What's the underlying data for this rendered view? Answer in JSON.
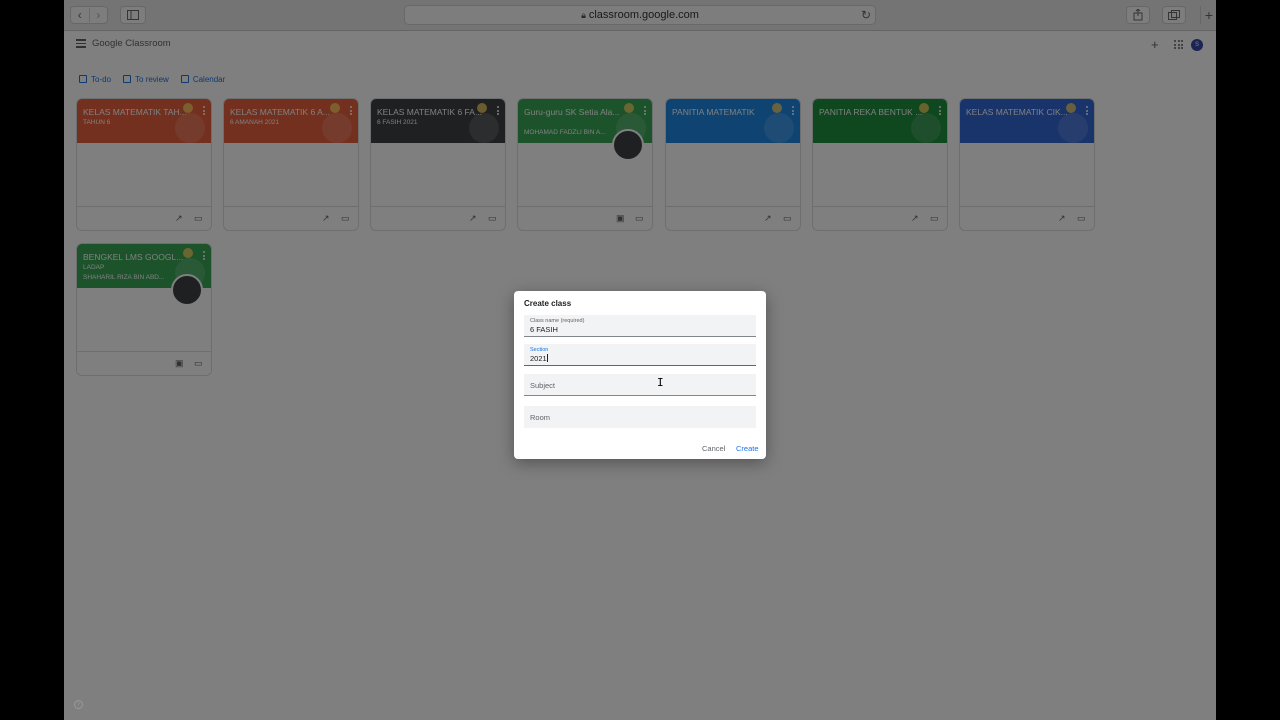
{
  "browser": {
    "url": "classroom.google.com",
    "back_icon": "chevron-left-icon",
    "forward_icon": "chevron-right-icon"
  },
  "appbar": {
    "brand_google": "Google",
    "brand_product": "Classroom",
    "avatar_initial": "S"
  },
  "subnav": [
    {
      "label": "To-do",
      "icon": "todo-icon"
    },
    {
      "label": "To review",
      "icon": "folder-icon"
    },
    {
      "label": "Calendar",
      "icon": "calendar-icon"
    }
  ],
  "cards": [
    {
      "title": "KELAS MATEMATIK TAH...",
      "section": "TAHUN 6",
      "owner": "",
      "color": "#e8613f"
    },
    {
      "title": "KELAS MATEMATIK 6 A...",
      "section": "6 AMANAH 2021",
      "owner": "",
      "color": "#e8613f"
    },
    {
      "title": "KELAS MATEMATIK 6 FA...",
      "section": "6 FASIH 2021",
      "owner": "",
      "color": "#3c4043"
    },
    {
      "title": "Guru-guru SK Setia Ala...",
      "section": "",
      "owner": "MOHAMAD FADZLI BIN A...",
      "color": "#3aa757"
    },
    {
      "title": "PANITIA MATEMATIK",
      "section": "",
      "owner": "",
      "color": "#1e88e5"
    },
    {
      "title": "PANITIA REKA BENTUK ...",
      "section": "",
      "owner": "",
      "color": "#1e8e3e"
    },
    {
      "title": "KELAS MATEMATIK CIK...",
      "section": "",
      "owner": "",
      "color": "#3367d6"
    },
    {
      "title": "BENGKEL LMS GOOGL...",
      "section": "LADAP",
      "owner": "SHAHARIL RIZA BIN ABD...",
      "color": "#3aa757"
    }
  ],
  "dialog": {
    "title": "Create class",
    "class_name_label": "Class name (required)",
    "class_name_value": "6 FASIH",
    "section_label": "Section",
    "section_value": "2021",
    "subject_placeholder": "Subject",
    "room_placeholder": "Room",
    "cancel_label": "Cancel",
    "create_label": "Create"
  },
  "help_icon": "?"
}
